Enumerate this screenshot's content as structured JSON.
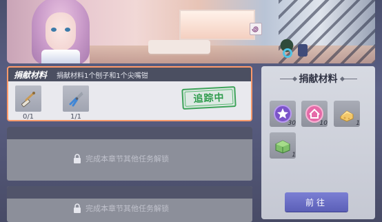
{
  "header": {
    "character": "portrait",
    "spiral_icon": "spiral-icon"
  },
  "task": {
    "title": "捐献材料",
    "description": "捐献材料1个刨子和1个尖嘴钳",
    "items": [
      {
        "icon": "plane-tool-icon",
        "count": "0/1"
      },
      {
        "icon": "pliers-icon",
        "count": "1/1"
      }
    ],
    "status_stamp": "追踪中"
  },
  "locked_tasks": [
    {
      "text": "完成本章节其他任务解锁"
    },
    {
      "text": "完成本章节其他任务解锁"
    }
  ],
  "side_panel": {
    "title": "捐献材料",
    "materials": [
      {
        "icon": "purple-star-badge-icon",
        "count": "30"
      },
      {
        "icon": "pink-home-badge-icon",
        "count": "10"
      },
      {
        "icon": "cheese-block-icon",
        "count": "1"
      },
      {
        "icon": "green-box-icon",
        "count": "1"
      }
    ],
    "goto_label": "前往"
  },
  "colors": {
    "accent_border": "#ff9a6b",
    "stamp_green": "#2f9c4d",
    "button": "#6a6ec6"
  }
}
